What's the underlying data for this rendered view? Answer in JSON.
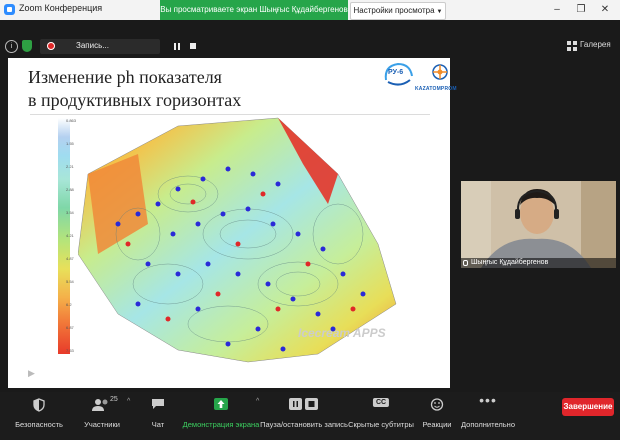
{
  "window": {
    "title": "Zoom Конференция",
    "share_banner": "Вы просматриваете экран Шыңғыс Құдайбергенов",
    "view_options": "Настройки просмотра",
    "controls": [
      "–",
      "❐",
      "✕"
    ]
  },
  "meeting_bar": {
    "recording_label": "Запись...",
    "gallery_label": "Галерея"
  },
  "slide": {
    "title_line1": "Изменение ph показателя",
    "title_line2": "в продуктивных горизонтах",
    "logo_ru6": "РУ-6",
    "logo_kaz": "KAZATOMPROM",
    "watermark": "Icecream APPS",
    "colorbar_ticks": [
      "0.863",
      "1.55",
      "2.21",
      "2.88",
      "3.54",
      "4.21",
      "4.87",
      "5.54",
      "6.2",
      "6.87",
      "7.53"
    ]
  },
  "participant": {
    "name": "Шыңғыс Құдайбергенов"
  },
  "toolbar": {
    "security": "Безопасность",
    "participants": "Участники",
    "participants_count": "25",
    "chat": "Чат",
    "share": "Демонстрация экрана",
    "record": "Пауза/остановить запись",
    "captions": "Скрытые субтитры",
    "captions_badge": "CC",
    "reactions": "Реакции",
    "more": "Дополнительно",
    "end": "Завершение"
  },
  "colors": {
    "share_green": "#26a54a",
    "end_red": "#e0262b",
    "toolbar_bg": "#1c1c1c"
  }
}
